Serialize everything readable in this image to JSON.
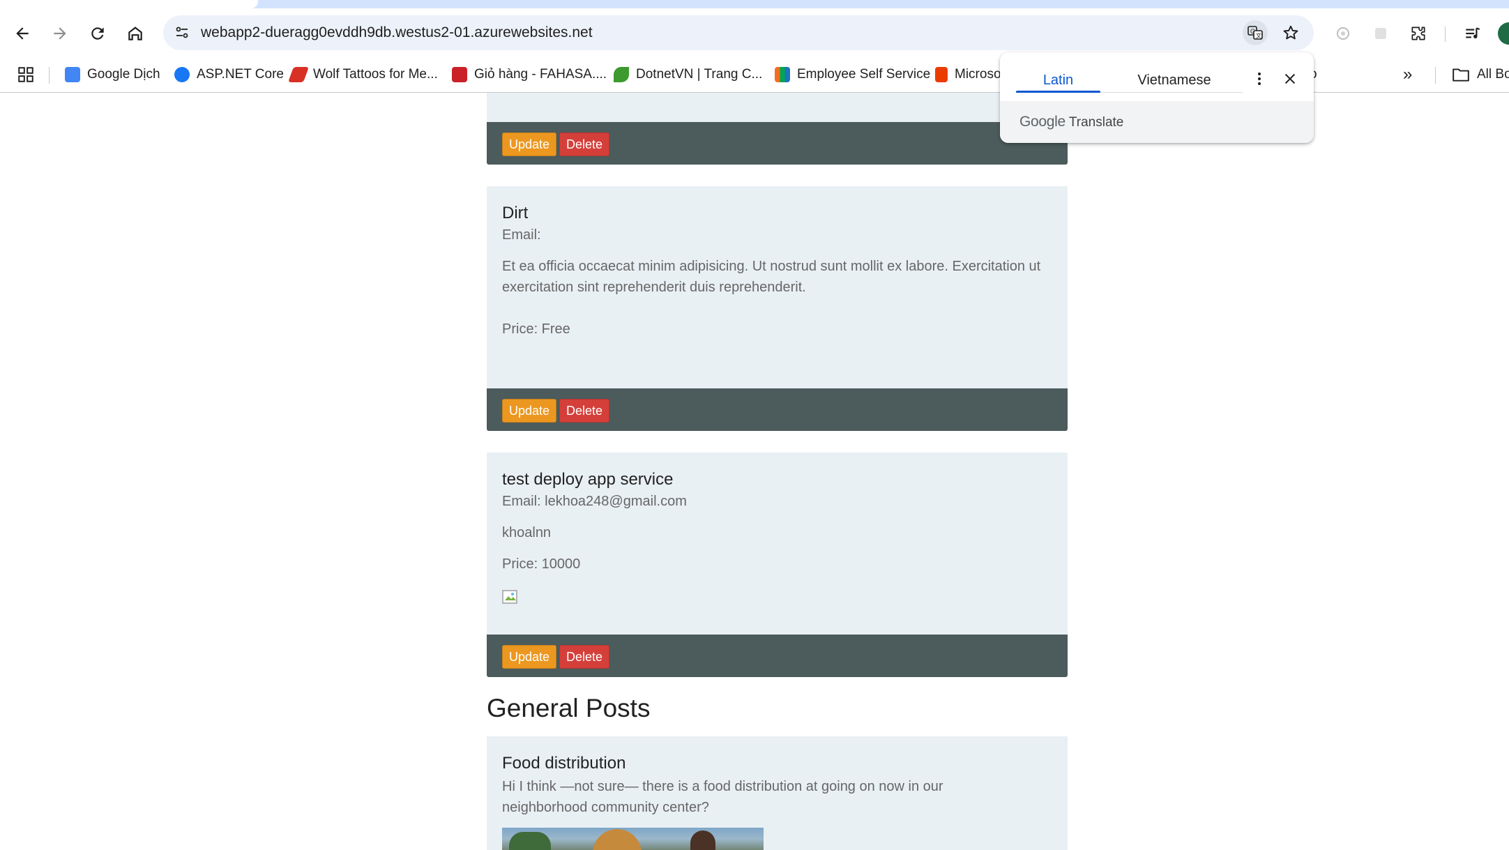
{
  "browser": {
    "url": "webapp2-dueragg0evddh9db.westus2-01.azurewebsites.net",
    "bookmarks": [
      {
        "label": "Google Dịch",
        "color": "#4285f4"
      },
      {
        "label": "ASP.NET Core",
        "color": "#1877f2"
      },
      {
        "label": "Wolf Tattoos for Me...",
        "color": "#d93025"
      },
      {
        "label": "Giỏ hàng - FAHASA....",
        "color": "#c92127"
      },
      {
        "label": "DotnetVN | Trang C...",
        "color": "#3c9a2e"
      },
      {
        "label": "Employee Self Service",
        "color": "#f26f21"
      },
      {
        "label": "Microso",
        "color": "#eb3c00"
      }
    ],
    "bookmarks_overflow": "»",
    "all_bookmarks": "All Bo",
    "hidden_bookmark_tail": "o"
  },
  "translate_popup": {
    "tabs": [
      {
        "label": "Latin",
        "active": true
      },
      {
        "label": "Vietnamese",
        "active": false
      }
    ],
    "brand_google": "Google",
    "brand_translate": "Translate"
  },
  "posts": [
    {
      "update_label": "Update",
      "delete_label": "Delete"
    },
    {
      "title": "Dirt",
      "email": "Email:",
      "description": "Et ea officia occaecat minim adipisicing. Ut nostrud sunt mollit ex labore. Exercitation ut exercitation sint reprehenderit duis reprehenderit.",
      "price": "Price: Free",
      "update_label": "Update",
      "delete_label": "Delete"
    },
    {
      "title": "test deploy app service",
      "email": "Email: lekhoa248@gmail.com",
      "description": "khoalnn",
      "price": "Price: 10000",
      "update_label": "Update",
      "delete_label": "Delete"
    }
  ],
  "general_heading": "General Posts",
  "general_posts": [
    {
      "title": "Food distribution",
      "description": "Hi I think —not sure— there is a food distribution at going on now in our neighborhood community center?"
    }
  ]
}
